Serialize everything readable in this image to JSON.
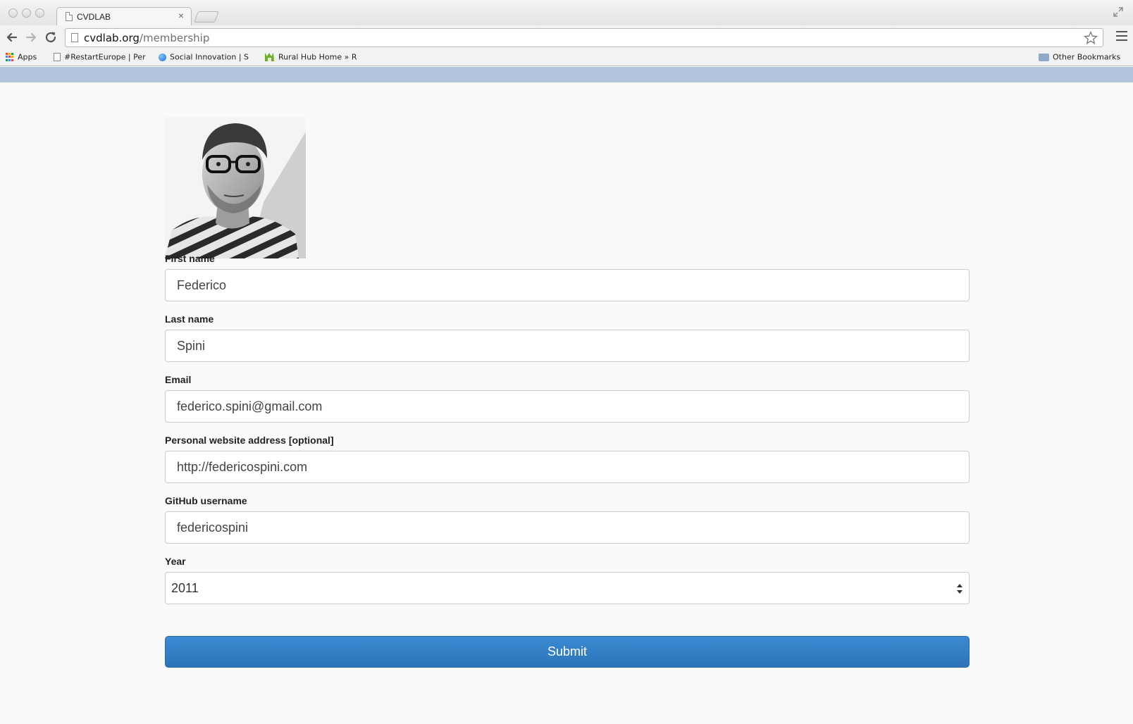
{
  "browser": {
    "tab_title": "CVDLAB",
    "tab_close": "×",
    "url_host": "cvdlab.org",
    "url_path": "/membership",
    "bookmarks": [
      {
        "icon": "apps-grid-icon",
        "label": "Apps",
        "faded": ""
      },
      {
        "icon": "page-icon",
        "label": "#RestartEurope | Per",
        "faded": ""
      },
      {
        "icon": "globe-icon",
        "label": "Social Innovation | S",
        "faded": ""
      },
      {
        "icon": "rural-hub-icon",
        "label": "Rural Hub Home » R",
        "faded": ""
      }
    ],
    "other_bookmarks": "Other Bookmarks"
  },
  "form": {
    "photo_alt": "member photo",
    "fields": [
      {
        "label": "First name",
        "value": "Federico"
      },
      {
        "label": "Last name",
        "value": "Spini"
      },
      {
        "label": "Email",
        "value": "federico.spini@gmail.com"
      },
      {
        "label": "Personal website address [optional]",
        "value": "http://federicospini.com"
      },
      {
        "label": "GitHub username",
        "value": "federicospini"
      }
    ],
    "year": {
      "label": "Year",
      "value": "2011"
    },
    "submit_label": "Submit"
  },
  "colors": {
    "header_band": "#b0c4de",
    "submit_button": "#3381c9"
  }
}
